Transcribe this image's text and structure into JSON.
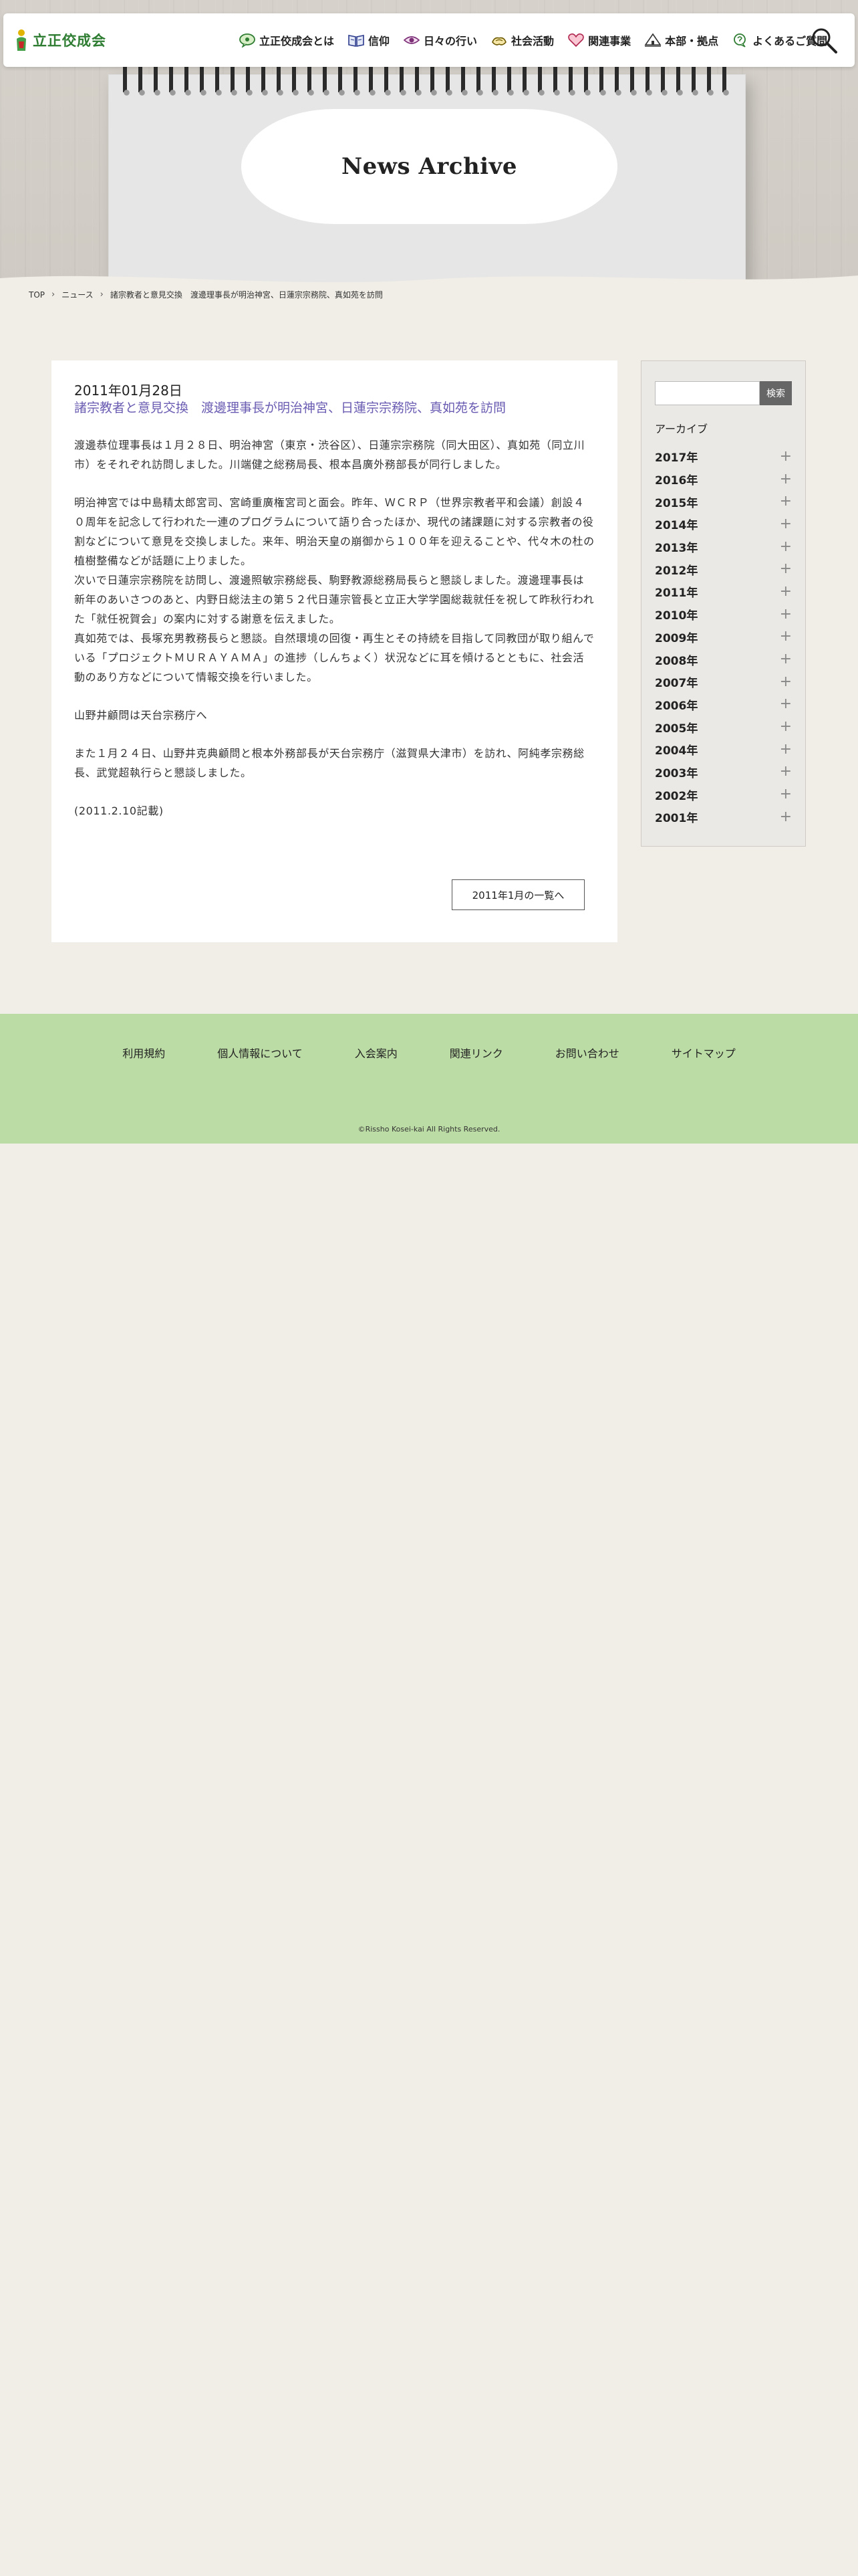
{
  "header": {
    "logo_text": "立正佼成会",
    "nav": [
      {
        "label": "立正佼成会とは",
        "icon": "speech-bubble-icon"
      },
      {
        "label": "信仰",
        "icon": "open-book-icon"
      },
      {
        "label": "日々の行い",
        "icon": "eye-icon"
      },
      {
        "label": "社会活動",
        "icon": "hands-icon"
      },
      {
        "label": "関連事業",
        "icon": "heart-icon"
      },
      {
        "label": "本部・拠点",
        "icon": "building-icon"
      },
      {
        "label": "よくあるご質問",
        "icon": "question-bubble-icon"
      }
    ],
    "search_icon": "search-icon"
  },
  "hero": {
    "title": "News Archive"
  },
  "breadcrumb": {
    "items": [
      "TOP",
      "ニュース",
      "諸宗教者と意見交換　渡邊理事長が明治神宮、日蓮宗宗務院、真如苑を訪問"
    ]
  },
  "article": {
    "date": "2011年01月28日",
    "title": "諸宗教者と意見交換　渡邊理事長が明治神宮、日蓮宗宗務院、真如苑を訪問",
    "paragraphs": [
      "渡邊恭位理事長は１月２８日、明治神宮（東京・渋谷区）、日蓮宗宗務院（同大田区）、真如苑（同立川市）をそれぞれ訪問しました。川端健之総務局長、根本昌廣外務部長が同行しました。",
      "明治神宮では中島精太郎宮司、宮崎重廣権宮司と面会。昨年、ＷＣＲＰ（世界宗教者平和会議）創設４０周年を記念して行われた一連のプログラムについて語り合ったほか、現代の諸課題に対する宗教者の役割などについて意見を交換しました。来年、明治天皇の崩御から１００年を迎えることや、代々木の杜の植樹整備などが話題に上りました。",
      "次いで日蓮宗宗務院を訪問し、渡邊照敏宗務総長、駒野教源総務局長らと懇談しました。渡邊理事長は新年のあいさつのあと、内野日総法主の第５２代日蓮宗管長と立正大学学園総裁就任を祝して昨秋行われた「就任祝賀会」の案内に対する謝意を伝えました。",
      "真如苑では、長塚充男教務長らと懇談。自然環境の回復・再生とその持続を目指して同教団が取り組んでいる「プロジェクトＭＵＲＡＹＡＭＡ」の進捗（しんちょく）状況などに耳を傾けるとともに、社会活動のあり方などについて情報交換を行いました。",
      "山野井顧問は天台宗務庁へ",
      "また１月２４日、山野井克典顧問と根本外務部長が天台宗務庁（滋賀県大津市）を訪れ、阿純孝宗務総長、武覚超執行らと懇談しました。",
      "(2011.2.10記載)"
    ],
    "back_label": "2011年1月の一覧へ"
  },
  "sidebar": {
    "search_placeholder": "",
    "search_button": "検索",
    "archive_title": "アーカイブ",
    "years": [
      "2017年",
      "2016年",
      "2015年",
      "2014年",
      "2013年",
      "2012年",
      "2011年",
      "2010年",
      "2009年",
      "2008年",
      "2007年",
      "2006年",
      "2005年",
      "2004年",
      "2003年",
      "2002年",
      "2001年"
    ]
  },
  "footer": {
    "links": [
      "利用規約",
      "個人情報について",
      "入会案内",
      "関連リンク",
      "お問い合わせ",
      "サイトマップ"
    ],
    "copyright": "©Rissho Kosei-kai All Rights Reserved."
  },
  "colors": {
    "accent_title": "#6a5bb2",
    "logo_green": "#2e7d32",
    "footer_bg": "#bcdca5",
    "page_bg": "#f1eee7"
  }
}
